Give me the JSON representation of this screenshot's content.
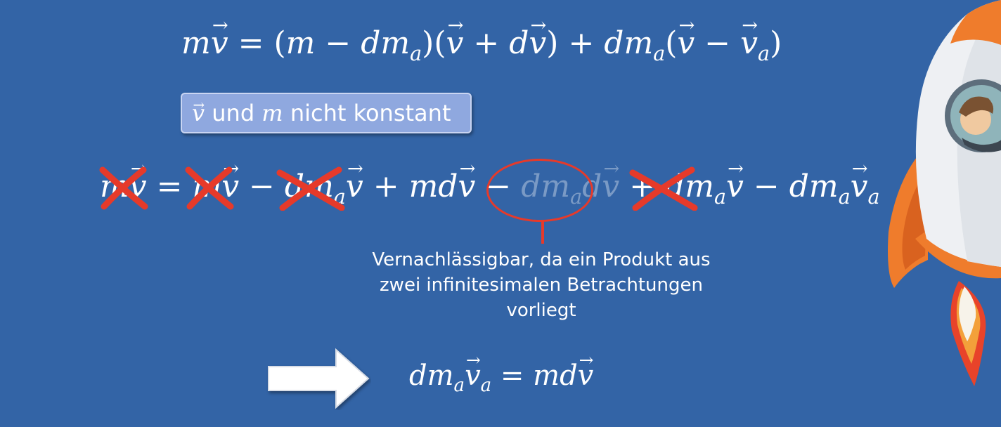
{
  "condition": {
    "text": " und ",
    "tail": " nicht konstant",
    "m": "m"
  },
  "note": {
    "line1": "Vernachlässigbar, da ein Produkt aus",
    "line2": "zwei infinitesimalen Betrachtungen",
    "line3": "vorliegt"
  },
  "colors": {
    "background": "#3364a6",
    "accent_red": "#e63a2a",
    "box_fill": "#8fa8df",
    "rocket_orange": "#ef7c2c"
  },
  "icons": [
    "cross-out-mark",
    "right-arrow-icon",
    "rocket-illustration"
  ]
}
